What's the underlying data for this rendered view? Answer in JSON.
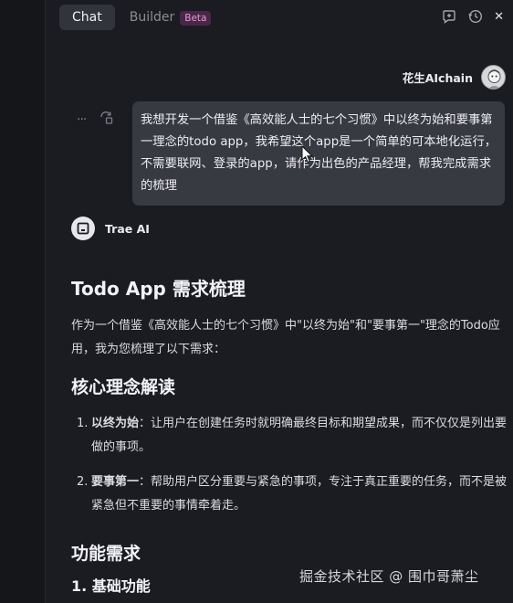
{
  "topbar": {
    "tab_chat": "Chat",
    "tab_builder": "Builder",
    "beta_badge": "Beta",
    "icons": [
      "new-chat-icon",
      "history-icon",
      "close-icon"
    ],
    "close_glyph": "✕"
  },
  "user": {
    "name": "花生AIchain"
  },
  "message": {
    "more_glyph": "···",
    "text": "我想开发一个借鉴《高效能人士的七个习惯》中以终为始和要事第一理念的todo app，我希望这个app是一个简单的可本地化运行，不需要联网、登录的app，请作为出色的产品经理，帮我完成需求的梳理"
  },
  "assistant": {
    "name": "Trae AI"
  },
  "response": {
    "title": "Todo App 需求梳理",
    "intro": "作为一个借鉴《高效能人士的七个习惯》中\"以终为始\"和\"要事第一\"理念的Todo应用，我为您梳理了以下需求：",
    "section1_title": "核心理念解读",
    "points": [
      {
        "num": "1.",
        "label": "以终为始",
        "text": "：让用户在创建任务时就明确最终目标和期望成果，而不仅仅是列出要做的事项。"
      },
      {
        "num": "2.",
        "label": "要事第一",
        "text": "：帮助用户区分重要与紧急的事项，专注于真正重要的任务，而不是被紧急但不重要的事情牵着走。"
      }
    ],
    "section2_title": "功能需求",
    "subsection": "1. 基础功能"
  },
  "watermark": "掘金技术社区 @ 围巾哥萧尘",
  "colors": {
    "background": "#1b1c22",
    "bubble": "#383a42",
    "beta_bg": "#4a2747",
    "beta_text": "#e39ad6"
  }
}
